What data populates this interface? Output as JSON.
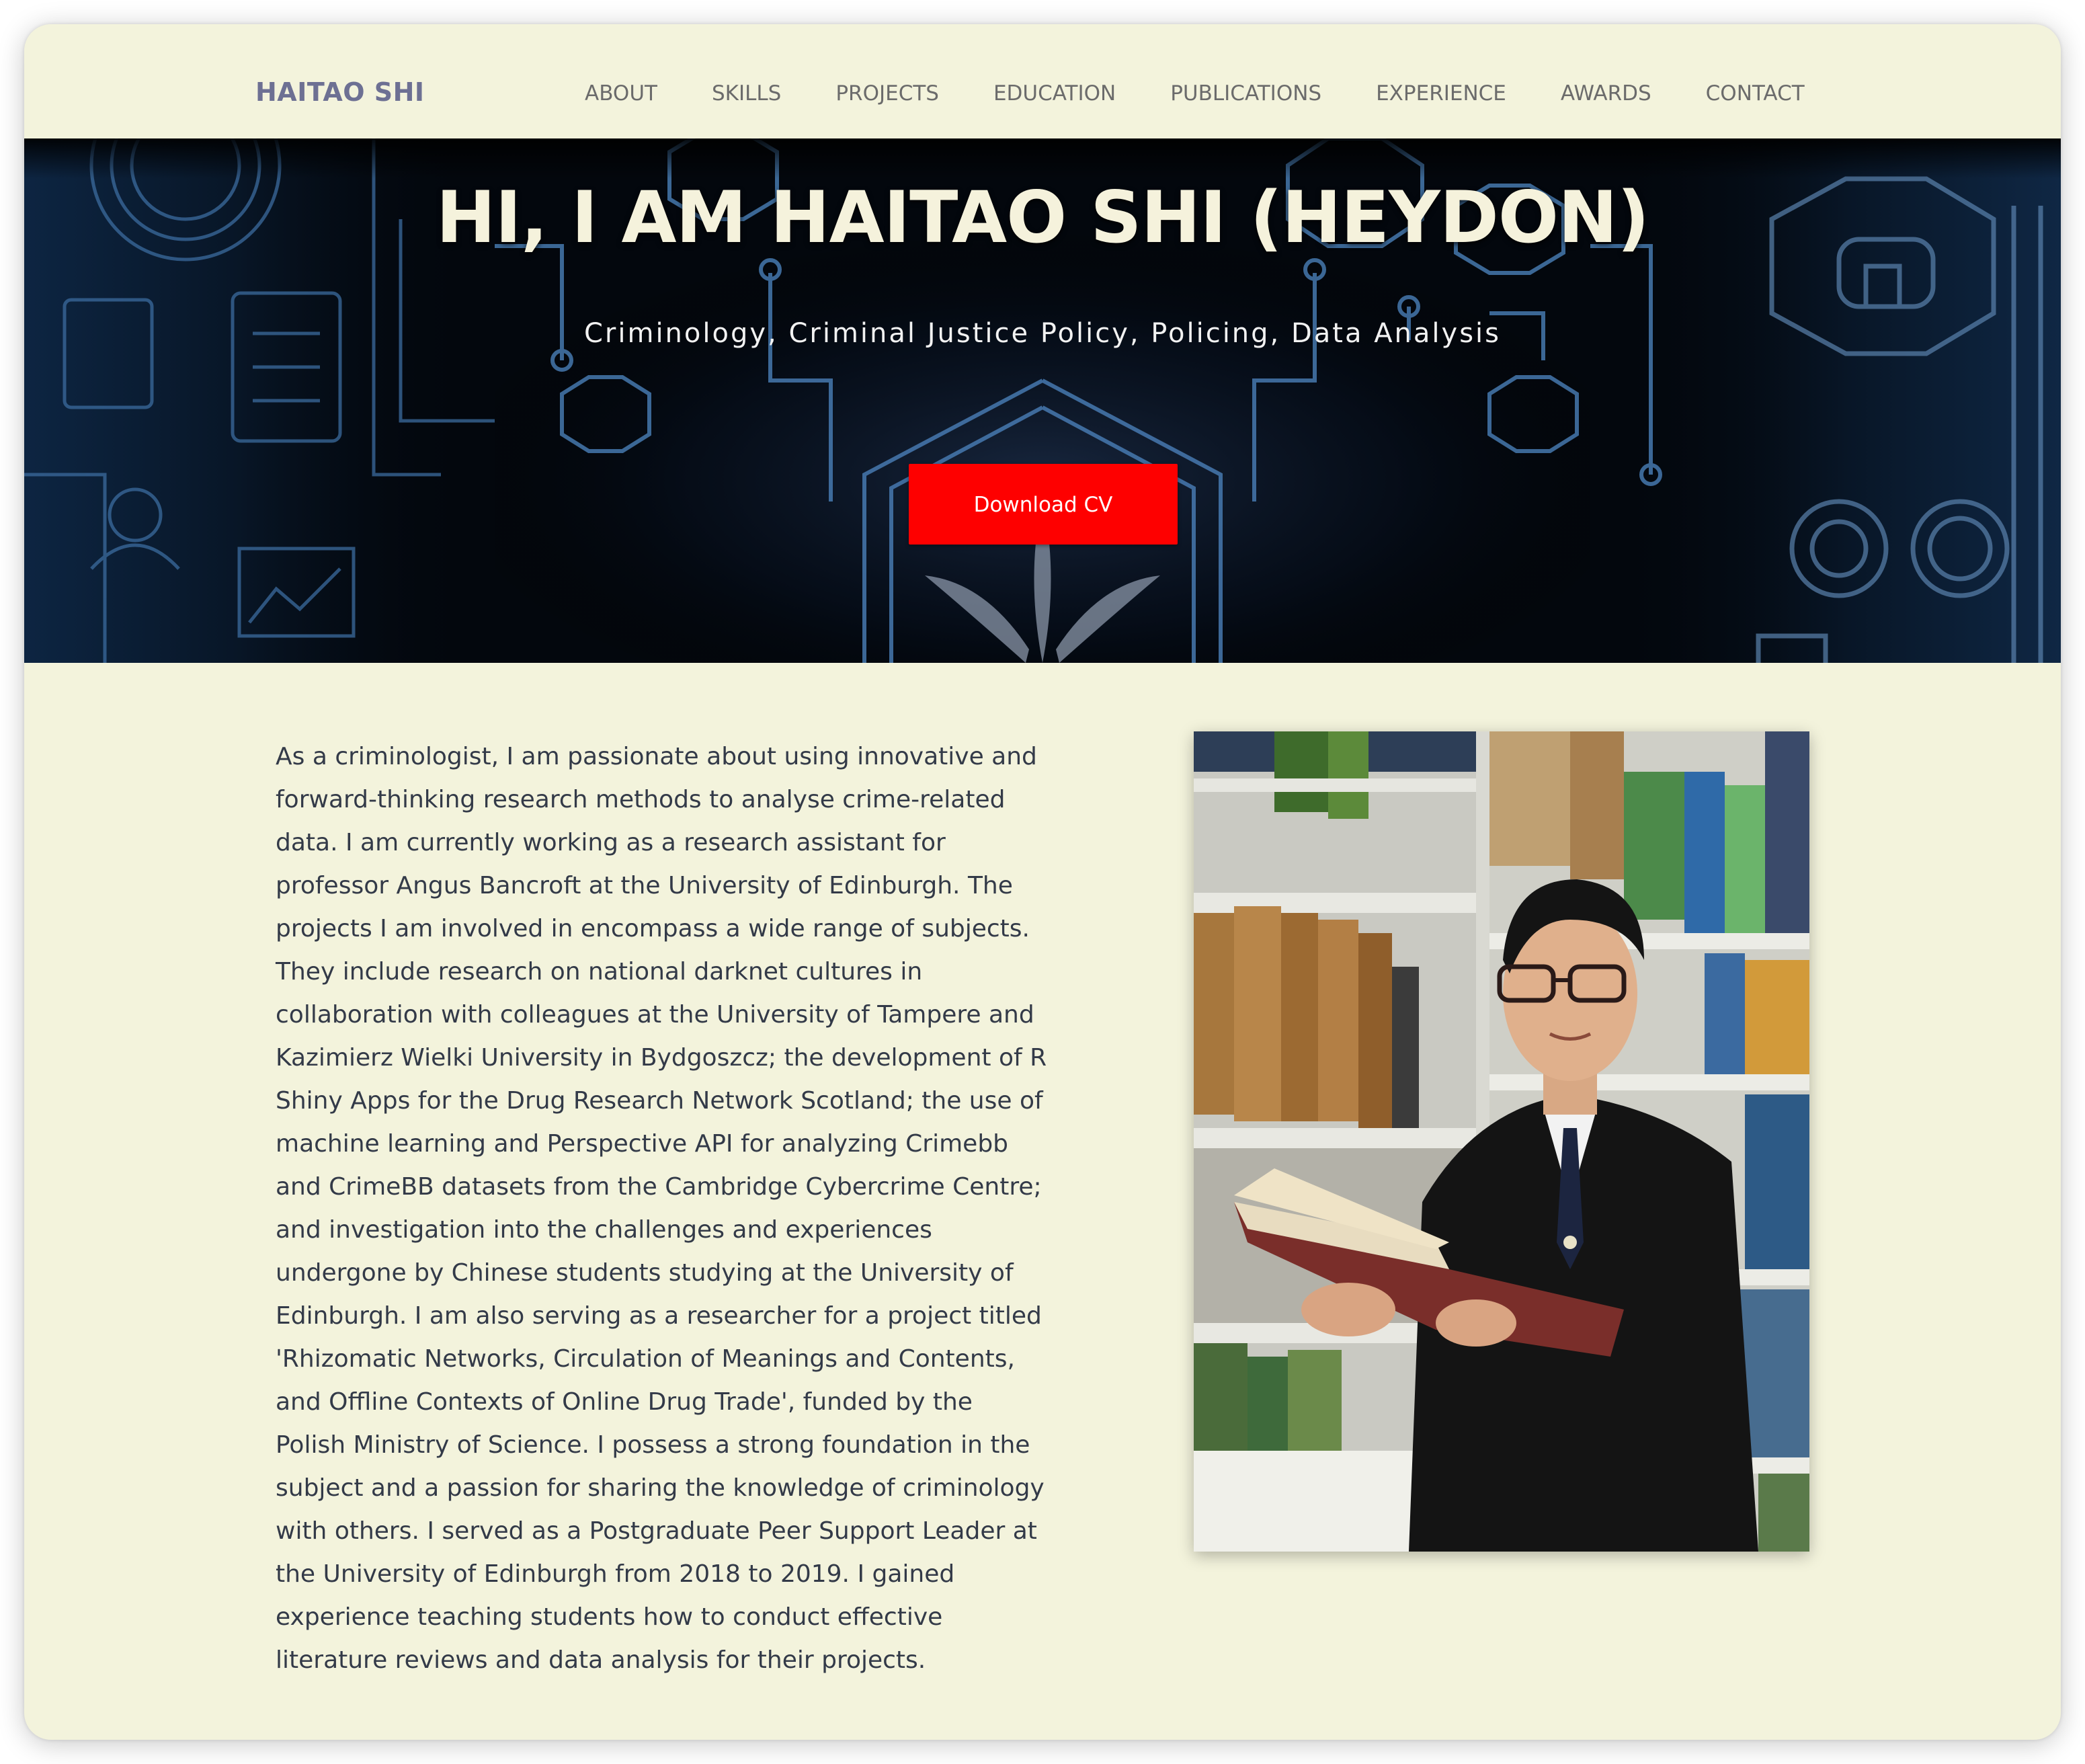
{
  "navbar": {
    "brand": "HAITAO SHI",
    "links": [
      {
        "label": "ABOUT"
      },
      {
        "label": "SKILLS"
      },
      {
        "label": "PROJECTS"
      },
      {
        "label": "EDUCATION"
      },
      {
        "label": "PUBLICATIONS"
      },
      {
        "label": "EXPERIENCE"
      },
      {
        "label": "AWARDS"
      },
      {
        "label": "CONTACT"
      }
    ]
  },
  "hero": {
    "title": "HI, I AM HAITAO SHI (HEYDON)",
    "subtitle": "Criminology, Criminal Justice Policy, Policing, Data Analysis",
    "button_label": "Download CV"
  },
  "about": {
    "text": "As a criminologist, I am passionate about using innovative and forward-thinking research methods to analyse crime-related data. I am currently working as a research assistant for professor Angus Bancroft at the University of Edinburgh. The projects I am involved in encompass a wide range of subjects. They include research on national darknet cultures in collaboration with colleagues at the University of Tampere and Kazimierz Wielki University in Bydgoszcz; the development of R Shiny Apps for the Drug Research Network Scotland; the use of machine learning and Perspective API for analyzing Crimebb and CrimeBB datasets from the Cambridge Cybercrime Centre; and investigation into the challenges and experiences undergone by Chinese students studying at the University of Edinburgh. I am also serving as a researcher for a project titled 'Rhizomatic Networks, Circulation of Meanings and Contents, and Offline Contexts of Online Drug Trade', funded by the Polish Ministry of Science. I possess a strong foundation in the subject and a passion for sharing the knowledge of criminology with others. I served as a Postgraduate Peer Support Leader at the University of Edinburgh from 2018 to 2019. I gained experience teaching students how to conduct effective literature reviews and data analysis for their projects."
  },
  "colors": {
    "page_background": "#f3f3dc",
    "brand": "#6d7093",
    "nav_link": "#6b6b6b",
    "hero_title": "#f5f2dc",
    "button": "#fe0000",
    "body_text": "#333a48"
  },
  "icons": {
    "hero_background": "circuit-network-illustration",
    "portrait": "person-reading-book-in-library-photo"
  }
}
